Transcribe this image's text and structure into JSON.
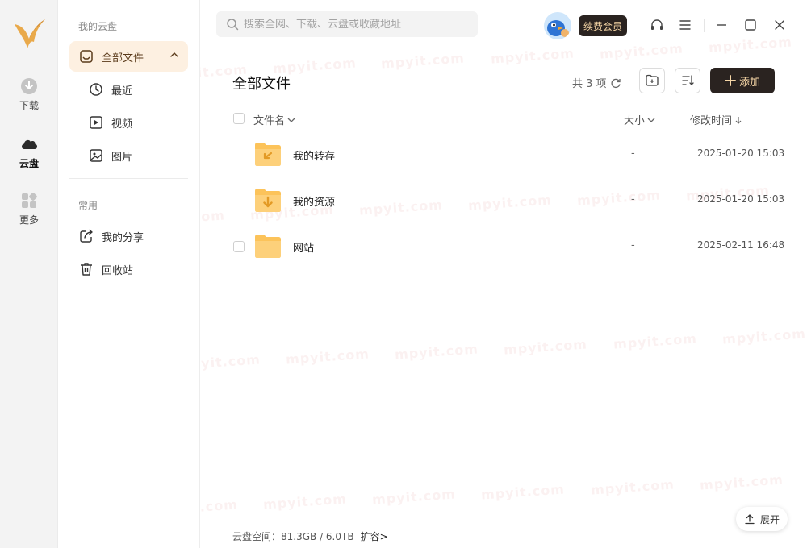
{
  "rail": {
    "items": [
      {
        "label": "下载",
        "icon": "download-icon"
      },
      {
        "label": "云盘",
        "icon": "cloud-icon",
        "active": true
      },
      {
        "label": "更多",
        "icon": "more-apps-icon"
      }
    ]
  },
  "sidebar": {
    "section_cloud": "我的云盘",
    "all_files": "全部文件",
    "recent": "最近",
    "video": "视频",
    "images": "图片",
    "section_common": "常用",
    "my_share": "我的分享",
    "recycle": "回收站"
  },
  "search": {
    "placeholder": "搜索全网、下载、云盘或收藏地址"
  },
  "header": {
    "vip_label": "续费会员"
  },
  "main": {
    "title": "全部文件",
    "count": "共 3 项",
    "add_label": "添加"
  },
  "table": {
    "col_name": "文件名",
    "col_size": "大小",
    "col_mtime": "修改时间",
    "rows": [
      {
        "name": "我的转存",
        "size": "-",
        "mtime": "2025-01-20 15:03",
        "icon": "folder-transfer-icon"
      },
      {
        "name": "我的资源",
        "size": "-",
        "mtime": "2025-01-20 15:03",
        "icon": "folder-download-icon"
      },
      {
        "name": "网站",
        "size": "-",
        "mtime": "2025-02-11 16:48",
        "icon": "folder-icon"
      }
    ]
  },
  "footer": {
    "storage": "云盘空间：81.3GB / 6.0TB",
    "expand_link": "扩容>",
    "expand_button": "展开"
  },
  "watermark": "mpyit.com",
  "colors": {
    "accent_bg": "#fdf0e1",
    "dark_button": "#2a2320",
    "gold_text": "#f6d6a6",
    "folder": "#fcc35a"
  }
}
